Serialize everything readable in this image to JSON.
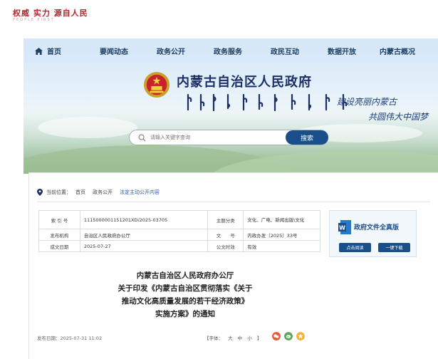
{
  "slogan": {
    "main": "权威 实力 源自人民",
    "sub": "PEOPLE FIRST"
  },
  "nav": {
    "items": [
      {
        "label": "首页",
        "icon": "home-icon"
      },
      {
        "label": "要闻动态"
      },
      {
        "label": "政务公开"
      },
      {
        "label": "政务服务"
      },
      {
        "label": "政民互动"
      },
      {
        "label": "数据开放"
      },
      {
        "label": "内蒙古概况"
      }
    ]
  },
  "header": {
    "title": "内蒙古自治区人民政府",
    "emblem_icon": "national-emblem-icon",
    "calligraphy": "建设亮丽内蒙古 共圆伟大中国梦"
  },
  "search": {
    "placeholder": "请输入关键字查询",
    "button_label": "搜索"
  },
  "breadcrumb": {
    "label": "当前位置：",
    "items": [
      "首页",
      "政务公开",
      "法定主动公开内容"
    ]
  },
  "meta": {
    "rows": [
      [
        {
          "k": "索 引 号",
          "v": "11150000011512​01XD/2025-03705"
        },
        {
          "k": "主题分类",
          "v": "文化、广电、新闻出版\\文化"
        }
      ],
      [
        {
          "k": "发布机构",
          "v": "自治区人民政府办公厅"
        },
        {
          "k": "文　　号",
          "v": "内政办发〔2025〕33号"
        }
      ],
      [
        {
          "k": "成文日期",
          "v": "2025-07-27"
        },
        {
          "k": "公文时效",
          "v": "有效"
        }
      ]
    ]
  },
  "sidebox": {
    "title": "政府文件全真版",
    "read_label": "点击阅读",
    "download_label": "一键下载"
  },
  "document": {
    "title_lines": [
      "内蒙古自治区人民政府办公厅",
      "关于印发《内蒙古自治区贯彻落实《关于",
      "推动文化高质量发展的若干经济政策》",
      "实施方案》的通知"
    ],
    "publish_label": "发布日期：",
    "publish_date": "2025-07-31 11:02",
    "font_size_label": "【字体：",
    "font_sizes": [
      "大",
      "中",
      "小"
    ],
    "font_size_end": "】"
  },
  "colors": {
    "brand": "#1b4f8a",
    "slogan": "#b5262b",
    "title": "#1b2f66"
  }
}
